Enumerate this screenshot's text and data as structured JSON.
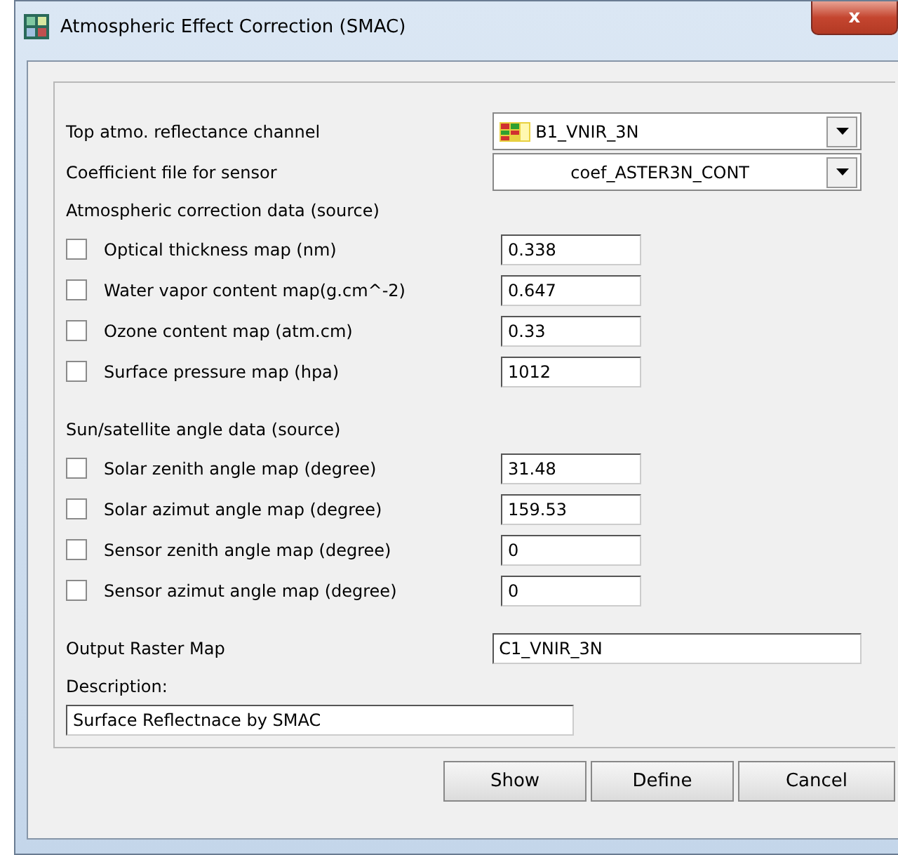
{
  "window": {
    "title": "Atmospheric Effect Correction (SMAC)",
    "close": "x"
  },
  "channel": {
    "label": "Top atmo. reflectance channel",
    "value": "B1_VNIR_3N"
  },
  "coef": {
    "label": "Coefficient file for sensor",
    "value": "coef_ASTER3N_CONT"
  },
  "sections": [
    {
      "title": "Atmospheric correction data (source)",
      "rows": [
        {
          "label": "Optical thickness map (nm)",
          "checked": false,
          "value": "0.338"
        },
        {
          "label": "Water vapor content map(g.cm^-2)",
          "checked": false,
          "value": "0.647"
        },
        {
          "label": "Ozone content map (atm.cm)",
          "checked": false,
          "value": "0.33"
        },
        {
          "label": "Surface pressure map (hpa)",
          "checked": false,
          "value": "1012"
        }
      ]
    },
    {
      "title": "Sun/satellite angle data (source)",
      "rows": [
        {
          "label": "Solar zenith angle map (degree)",
          "checked": false,
          "value": "31.48"
        },
        {
          "label": "Solar azimut angle map (degree)",
          "checked": false,
          "value": "159.53"
        },
        {
          "label": "Sensor zenith angle map (degree)",
          "checked": false,
          "value": "0"
        },
        {
          "label": "Sensor azimut angle map (degree)",
          "checked": false,
          "value": "0"
        }
      ]
    }
  ],
  "output": {
    "label": "Output Raster Map",
    "value": "C1_VNIR_3N"
  },
  "description": {
    "label": "Description:",
    "value": "Surface Reflectnace by SMAC"
  },
  "buttons": [
    "Show",
    "Define",
    "Cancel"
  ]
}
